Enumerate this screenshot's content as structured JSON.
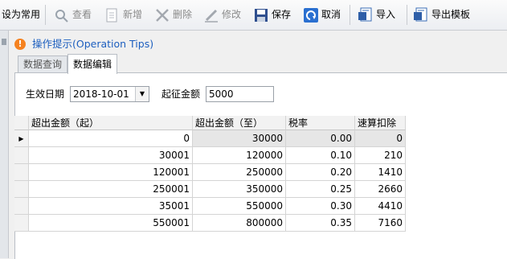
{
  "toolbar": {
    "set_common": "设为常用",
    "view": "查看",
    "add": "新增",
    "delete": "删除",
    "edit": "修改",
    "save": "保存",
    "cancel": "取消",
    "import": "导入",
    "export_template": "导出模板"
  },
  "tips": {
    "text": "操作提示(Operation Tips)"
  },
  "tabs": [
    {
      "label": "数据查询",
      "active": false
    },
    {
      "label": "数据编辑",
      "active": true
    }
  ],
  "form": {
    "effective_date_label": "生效日期",
    "effective_date_value": "2018-10-01",
    "threshold_label": "起征金额",
    "threshold_value": "5000"
  },
  "grid": {
    "columns": [
      "超出金额（起）",
      "超出金额（至）",
      "税率",
      "速算扣除数"
    ],
    "rows": [
      [
        "0",
        "30000",
        "0.00",
        "0"
      ],
      [
        "30001",
        "120000",
        "0.10",
        "210"
      ],
      [
        "120001",
        "250000",
        "0.20",
        "1410"
      ],
      [
        "250001",
        "350000",
        "0.25",
        "2660"
      ],
      [
        "35001",
        "550000",
        "0.30",
        "4410"
      ],
      [
        "550001",
        "800000",
        "0.35",
        "7160"
      ]
    ],
    "selected_row": 0
  }
}
